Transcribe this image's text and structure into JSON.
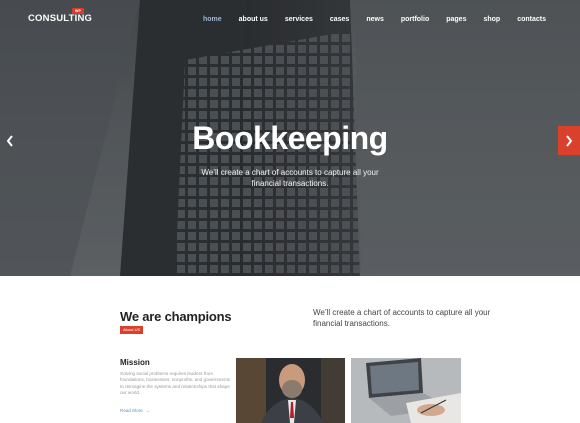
{
  "brand": {
    "name": "CONSULTING",
    "badge": "WP"
  },
  "nav": {
    "items": [
      "home",
      "about us",
      "services",
      "cases",
      "news",
      "portfolio",
      "pages",
      "shop",
      "contacts"
    ],
    "active": "home"
  },
  "hero": {
    "title": "Bookkeeping",
    "subtitle": "We’ll create a chart of accounts to capture all your financial transactions."
  },
  "intro": {
    "title": "We are champions",
    "badge": "About US",
    "text": "We’ll create a chart of accounts to capture all your financial transactions."
  },
  "mission": {
    "title": "Mission",
    "text": "Solving social problems requires leaders from foundations, businesses, nonprofits, and governments to reimagine the systems and relationships that shape our world.",
    "read_more": "Read More"
  },
  "colors": {
    "accent": "#d9412c",
    "active_nav": "#9fb6d2"
  },
  "icons": {
    "prev": "chevron-left-icon",
    "next": "chevron-right-icon"
  }
}
